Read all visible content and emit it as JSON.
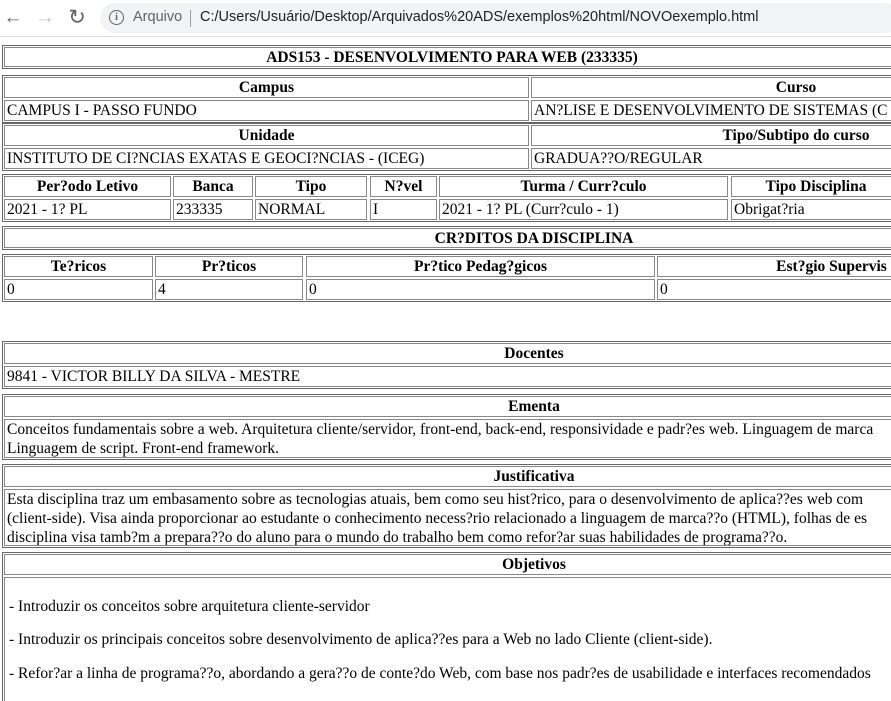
{
  "browser": {
    "scheme_label": "Arquivo",
    "url": "C:/Users/Usuário/Desktop/Arquivados%20ADS/exemplos%20html/NOVOexemplo.html",
    "back_glyph": "←",
    "forward_glyph": "→",
    "reload_glyph": "↻",
    "info_glyph": "i"
  },
  "title": "ADS153 - DESENVOLVIMENTO PARA WEB (233335)",
  "campus": {
    "label": "Campus",
    "value": "CAMPUS I - PASSO FUNDO"
  },
  "curso": {
    "label": "Curso",
    "value": "AN?LISE E DESENVOLVIMENTO DE SISTEMAS (C"
  },
  "unidade": {
    "label": "Unidade",
    "value": "INSTITUTO DE CI?NCIAS EXATAS E GEOCI?NCIAS - (ICEG)"
  },
  "tipo_curso": {
    "label": "Tipo/Subtipo do curso",
    "value": "GRADUA??O/REGULAR"
  },
  "info_headers": [
    "Per?odo Letivo",
    "Banca",
    "Tipo",
    "N?vel",
    "Turma / Curr?culo",
    "Tipo Disciplina"
  ],
  "info_values": [
    "2021 - 1? PL",
    "233335",
    "NORMAL",
    "I",
    "2021 - 1? PL (Curr?culo - 1)",
    "Obrigat?ria"
  ],
  "creditos_title": "CR?DITOS DA DISCIPLINA",
  "creditos_headers": [
    "Te?ricos",
    "Pr?ticos",
    "Pr?tico Pedag?gicos",
    "Est?gio Supervis"
  ],
  "creditos_values": [
    "0",
    "4",
    "0",
    "0"
  ],
  "docentes": {
    "label": "Docentes",
    "value": "9841 - VICTOR BILLY DA SILVA - MESTRE"
  },
  "ementa": {
    "label": "Ementa",
    "lines": [
      "Conceitos fundamentais sobre a web. Arquitetura cliente/servidor, front-end, back-end, responsividade e padr?es web. Linguagem de marca",
      "Linguagem de script. Front-end framework."
    ]
  },
  "justificativa": {
    "label": "Justificativa",
    "lines": [
      "Esta disciplina traz um embasamento sobre as tecnologias atuais, bem como seu hist?rico, para o desenvolvimento de aplica??es web com",
      "(client-side). Visa ainda proporcionar ao estudante o conhecimento necess?rio relacionado a linguagem de marca??o (HTML), folhas de es",
      "disciplina visa tamb?m a prepara??o do aluno para o mundo do trabalho bem como refor?ar suas habilidades de programa??o."
    ]
  },
  "objetivos": {
    "label": "Objetivos",
    "items": [
      "- Introduzir os conceitos sobre arquitetura cliente-servidor",
      "- Introduzir os principais conceitos sobre desenvolvimento de aplica??es para a Web no lado Cliente (client-side).",
      "- Refor?ar a linha de programa??o, abordando a gera??o de conte?do Web, com base nos padr?es de usabilidade e interfaces recomendados"
    ]
  }
}
